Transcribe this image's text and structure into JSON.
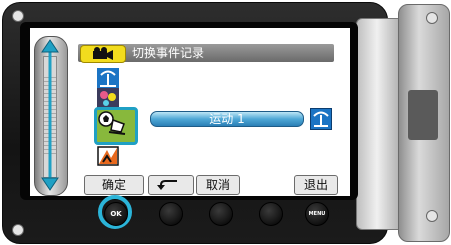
{
  "menu": {
    "title": "切换事件记录",
    "mode_icon": "movie-camera-icon",
    "selected_value": "运动 1"
  },
  "event_icons": [
    "beach-icon",
    "night-icon",
    "sports-icon",
    "activity-icon"
  ],
  "softkeys": {
    "confirm": "确定",
    "back_icon": "return-arrow-icon",
    "cancel": "取消",
    "exit": "退出"
  },
  "hardware": {
    "ok_label": "OK",
    "menu_label": "MENU"
  },
  "colors": {
    "highlight": "#1fa0c4",
    "title_bar": "#7a7a7a",
    "mode_badge": "#f2dc1e",
    "value_bar": "#4fa8d6"
  }
}
